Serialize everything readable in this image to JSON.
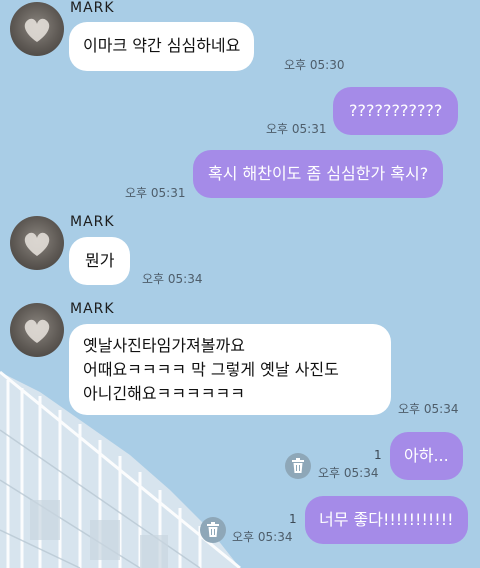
{
  "chat": {
    "sender_name": "MARK",
    "messages": [
      {
        "side": "in",
        "text": "이마크 약간 심심하네요",
        "time": "오후 05:30"
      },
      {
        "side": "out",
        "text": "???????????",
        "time": "오후 05:31"
      },
      {
        "side": "out",
        "text": "혹시 해찬이도 좀 심심한가 혹시?",
        "time": "오후 05:31"
      },
      {
        "side": "in",
        "text": "뭔가",
        "time": "오후 05:34"
      },
      {
        "side": "in",
        "lines": [
          "옛날사진타임가져볼까요",
          "어때요ㅋㅋㅋㅋ 막 그렇게 옛날 사진도",
          "아니긴해요ㅋㅋㅋㅋㅋㅋ"
        ],
        "time": "오후 05:34"
      },
      {
        "side": "out",
        "text": "아하...",
        "time": "오후 05:34",
        "unread": "1"
      },
      {
        "side": "out",
        "text": "너무 좋다!!!!!!!!!!!",
        "time": "오후 05:34",
        "unread": "1"
      }
    ]
  },
  "colors": {
    "background": "#a9cde6",
    "outgoing_bubble": "#a58be8",
    "incoming_bubble": "#ffffff"
  },
  "icons": {
    "trash": "trash-icon",
    "avatar_image": "heart-hands-photo"
  }
}
